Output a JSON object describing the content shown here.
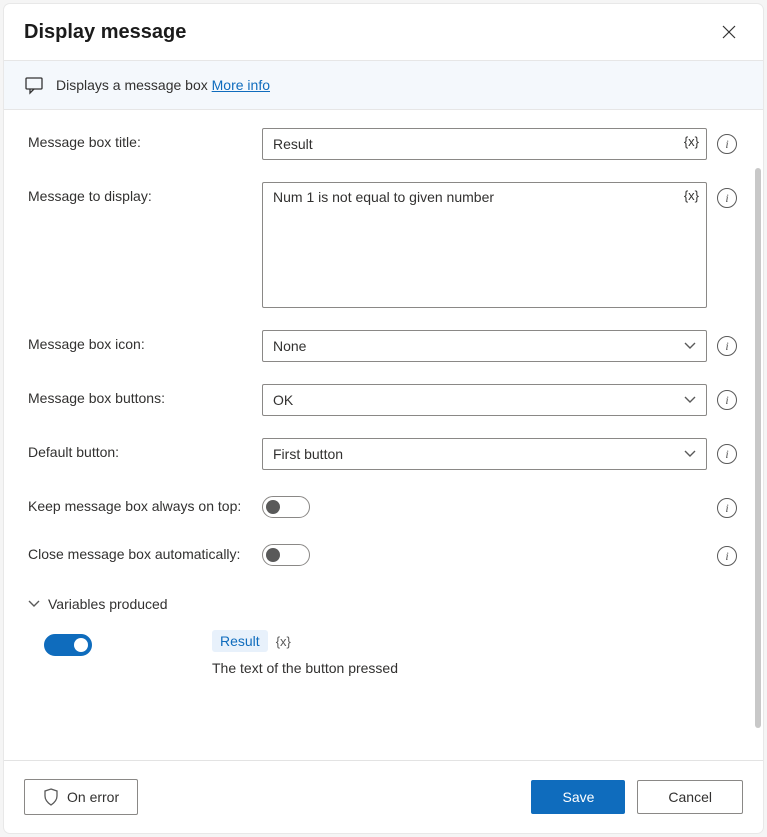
{
  "header": {
    "title": "Display message"
  },
  "description": {
    "text": "Displays a message box",
    "more_info": "More info"
  },
  "fields": {
    "title": {
      "label": "Message box title:",
      "value": "Result",
      "var_symbol": "{x}"
    },
    "message": {
      "label": "Message to display:",
      "value": "Num 1 is not equal to given number",
      "var_symbol": "{x}"
    },
    "icon": {
      "label": "Message box icon:",
      "value": "None"
    },
    "buttons": {
      "label": "Message box buttons:",
      "value": "OK"
    },
    "default_button": {
      "label": "Default button:",
      "value": "First button"
    },
    "always_on_top": {
      "label": "Keep message box always on top:"
    },
    "auto_close": {
      "label": "Close message box automatically:"
    }
  },
  "variables_section": {
    "title": "Variables produced",
    "variable": {
      "name": "Result",
      "symbol": "{x}",
      "description": "The text of the button pressed"
    }
  },
  "footer": {
    "on_error": "On error",
    "save": "Save",
    "cancel": "Cancel"
  }
}
